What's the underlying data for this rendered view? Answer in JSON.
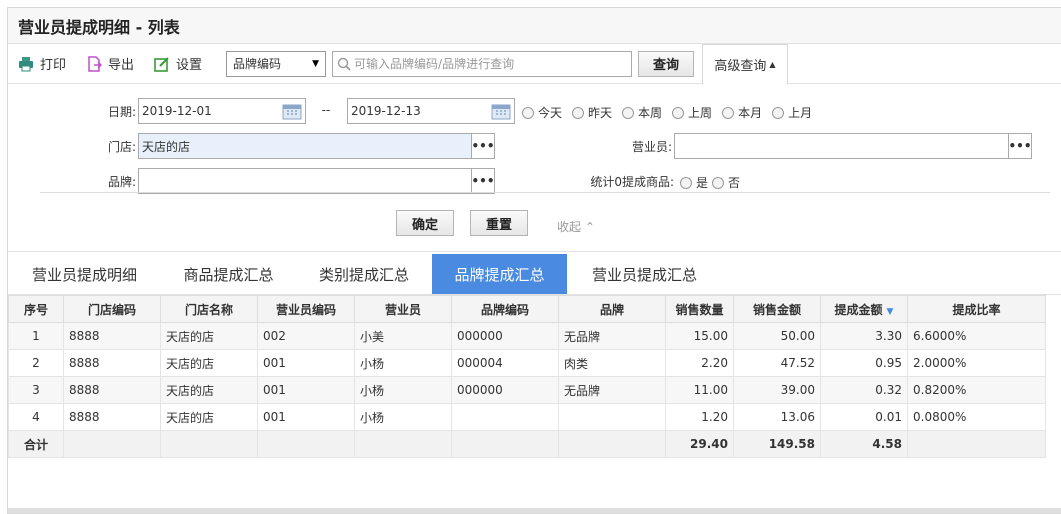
{
  "window": {
    "title": "营业员提成明细 - 列表"
  },
  "toolbar": {
    "print_label": "打印",
    "export_label": "导出",
    "settings_label": "设置",
    "field_select": "品牌编码",
    "search_placeholder": "可输入品牌编码/品牌进行查询",
    "query_label": "查询",
    "advanced_label": "高级查询"
  },
  "filter": {
    "date_label": "日期:",
    "date_from": "2019-12-01",
    "date_sep": "--",
    "date_to": "2019-12-13",
    "quick_dates": [
      "今天",
      "昨天",
      "本周",
      "上周",
      "本月",
      "上月"
    ],
    "store_label": "门店:",
    "store_value": "天店的店",
    "salesperson_label": "营业员:",
    "salesperson_value": "",
    "brand_label": "品牌:",
    "brand_value": "",
    "zero_label": "统计0提成商品:",
    "zero_options": [
      "是",
      "否"
    ],
    "confirm_label": "确定",
    "reset_label": "重置",
    "collapse_label": "收起"
  },
  "tabs": [
    {
      "label": "营业员提成明细",
      "active": false
    },
    {
      "label": "商品提成汇总",
      "active": false
    },
    {
      "label": "类别提成汇总",
      "active": false
    },
    {
      "label": "品牌提成汇总",
      "active": true
    },
    {
      "label": "营业员提成汇总",
      "active": false
    }
  ],
  "table": {
    "headers": [
      "序号",
      "门店编码",
      "门店名称",
      "营业员编码",
      "营业员",
      "品牌编码",
      "品牌",
      "销售数量",
      "销售金额",
      "提成金额",
      "提成比率"
    ],
    "rows": [
      [
        "1",
        "8888",
        "天店的店",
        "002",
        "小美",
        "000000",
        "无品牌",
        "15.00",
        "50.00",
        "3.30",
        "6.6000%"
      ],
      [
        "2",
        "8888",
        "天店的店",
        "001",
        "小杨",
        "000004",
        "肉类",
        "2.20",
        "47.52",
        "0.95",
        "2.0000%"
      ],
      [
        "3",
        "8888",
        "天店的店",
        "001",
        "小杨",
        "000000",
        "无品牌",
        "11.00",
        "39.00",
        "0.32",
        "0.8200%"
      ],
      [
        "4",
        "8888",
        "天店的店",
        "001",
        "小杨",
        "",
        "",
        "1.20",
        "13.06",
        "0.01",
        "0.0800%"
      ]
    ],
    "total": [
      "合计",
      "",
      "",
      "",
      "",
      "",
      "",
      "29.40",
      "149.58",
      "4.58",
      ""
    ]
  },
  "colors": {
    "accent": "#4a8ae0"
  }
}
